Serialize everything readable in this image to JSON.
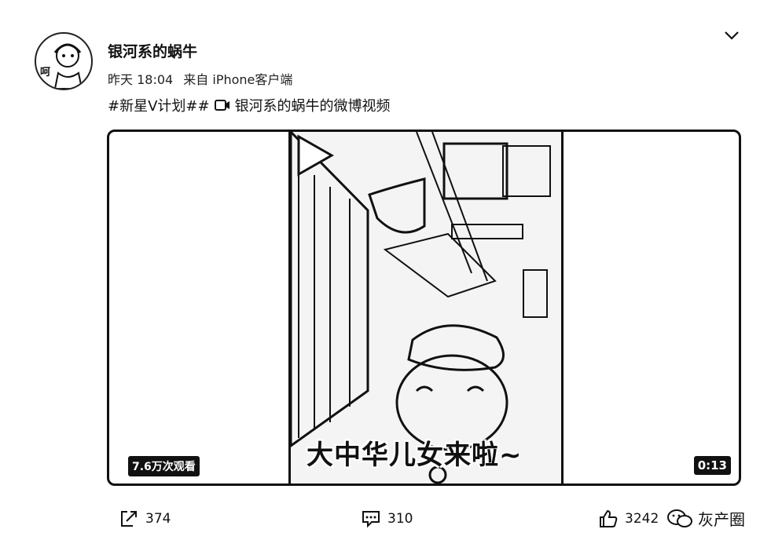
{
  "post": {
    "username": "银河系的蜗牛",
    "avatar_text": "呵",
    "time": "昨天 18:04",
    "source": "来自 iPhone客户端",
    "hashtag": "#新星V计划##",
    "video_link": "银河系的蜗牛的微博视频"
  },
  "video": {
    "caption": "大中华儿女来啦~",
    "views": "7.6万次观看",
    "duration": "0:13"
  },
  "actions": {
    "share_count": "374",
    "comment_count": "310",
    "like_count": "3242"
  },
  "watermark": {
    "text": "灰产圈"
  },
  "icons": [
    "chevron-down-icon",
    "video-icon",
    "play-icon",
    "share-icon",
    "comment-icon",
    "like-icon",
    "wechat-icon"
  ]
}
